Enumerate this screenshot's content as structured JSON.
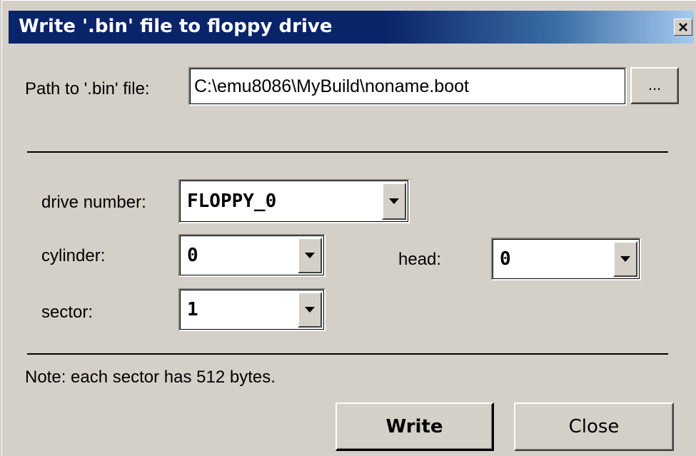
{
  "window": {
    "title": "Write '.bin' file to floppy drive",
    "close_icon": "close-icon"
  },
  "path": {
    "label": "Path to '.bin' file:",
    "value": "C:\\emu8086\\MyBuild\\noname.boot",
    "browse_label": "..."
  },
  "drive": {
    "label": "drive number:",
    "value": "FLOPPY_0"
  },
  "cylinder": {
    "label": "cylinder:",
    "value": "0"
  },
  "head": {
    "label": "head:",
    "value": "0"
  },
  "sector": {
    "label": "sector:",
    "value": "1"
  },
  "note": "Note: each sector has 512 bytes.",
  "buttons": {
    "write": "Write",
    "close": "Close"
  },
  "colors": {
    "face": "#d4d0c8",
    "title_start": "#0a246a",
    "title_end": "#a6caf0"
  }
}
